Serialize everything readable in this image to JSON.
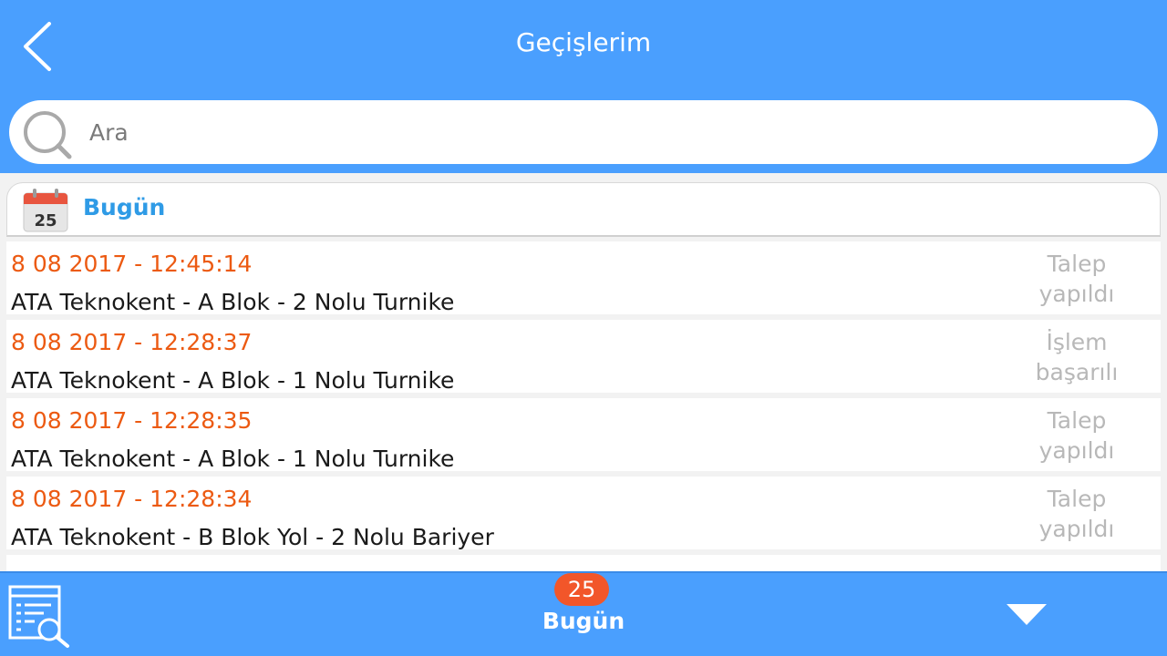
{
  "header": {
    "title": "Geçişlerim",
    "back_icon": "chevron-left-icon"
  },
  "search": {
    "placeholder": "Ara",
    "value": "",
    "icon": "search-icon"
  },
  "section": {
    "calendar_day": "25",
    "label": "Bugün",
    "icon": "calendar-icon"
  },
  "transitions": [
    {
      "time": "8 08 2017 - 12:45:14",
      "location": "ATA Teknokent - A Blok - 2 Nolu Turnike",
      "status_line1": "Talep",
      "status_line2": "yapıldı"
    },
    {
      "time": "8 08 2017 - 12:28:37",
      "location": "ATA Teknokent - A Blok - 1 Nolu Turnike",
      "status_line1": "İşlem",
      "status_line2": "başarılı"
    },
    {
      "time": "8 08 2017 - 12:28:35",
      "location": "ATA Teknokent - A Blok - 1 Nolu Turnike",
      "status_line1": "Talep",
      "status_line2": "yapıldı"
    },
    {
      "time": "8 08 2017 - 12:28:34",
      "location": "ATA Teknokent - B Blok Yol - 2 Nolu Bariyer",
      "status_line1": "Talep",
      "status_line2": "yapıldı"
    }
  ],
  "footer": {
    "count": "25",
    "label": "Bugün",
    "report_icon": "report-search-icon",
    "dropdown_icon": "triangle-down-icon"
  },
  "colors": {
    "primary": "#4a9ffe",
    "time_text": "#ec5a12",
    "section_label": "#2f9be6",
    "status_text": "#b8b8b8",
    "badge": "#f2562a"
  }
}
